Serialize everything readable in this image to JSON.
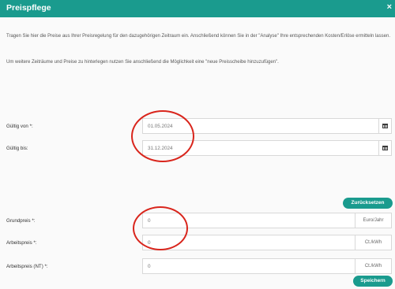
{
  "dialog": {
    "title": "Preispflege",
    "close_glyph": "×",
    "description_1": "Tragen Sie hier die Preise aus Ihrer Preisregelung für den dazugehörigen Zeitraum ein. Anschließend können Sie in der \"Analyse\" Ihre entsprechenden Kosten/Erlöse ermitteln lassen.",
    "description_2": "Um weitere Zeiträume und Preise zu hinterlegen nutzen Sie anschließend die Möglichkeit eine \"neue Preisscheibe hinzuzufügen\"."
  },
  "validity": {
    "from_label": "Gültig von *:",
    "from_value": "01.05.2024",
    "to_label": "Gültig bis:",
    "to_value": "31.12.2024",
    "calendar_icon": "calendar-icon"
  },
  "reset_button": "Zurücksetzen",
  "prices": {
    "base_label": "Grundpreis *:",
    "base_value": "0",
    "base_unit": "Euro/Jahr",
    "work_label": "Arbeitspreis *:",
    "work_value": "0",
    "work_unit": "Ct./kWh",
    "work_nt_label": "Arbeitspreis (NT) *:",
    "work_nt_value": "0",
    "work_nt_unit": "Ct./kWh"
  },
  "save_button": "Speichern",
  "colors": {
    "accent": "#1a9b8e",
    "annotation": "#d9251c"
  }
}
